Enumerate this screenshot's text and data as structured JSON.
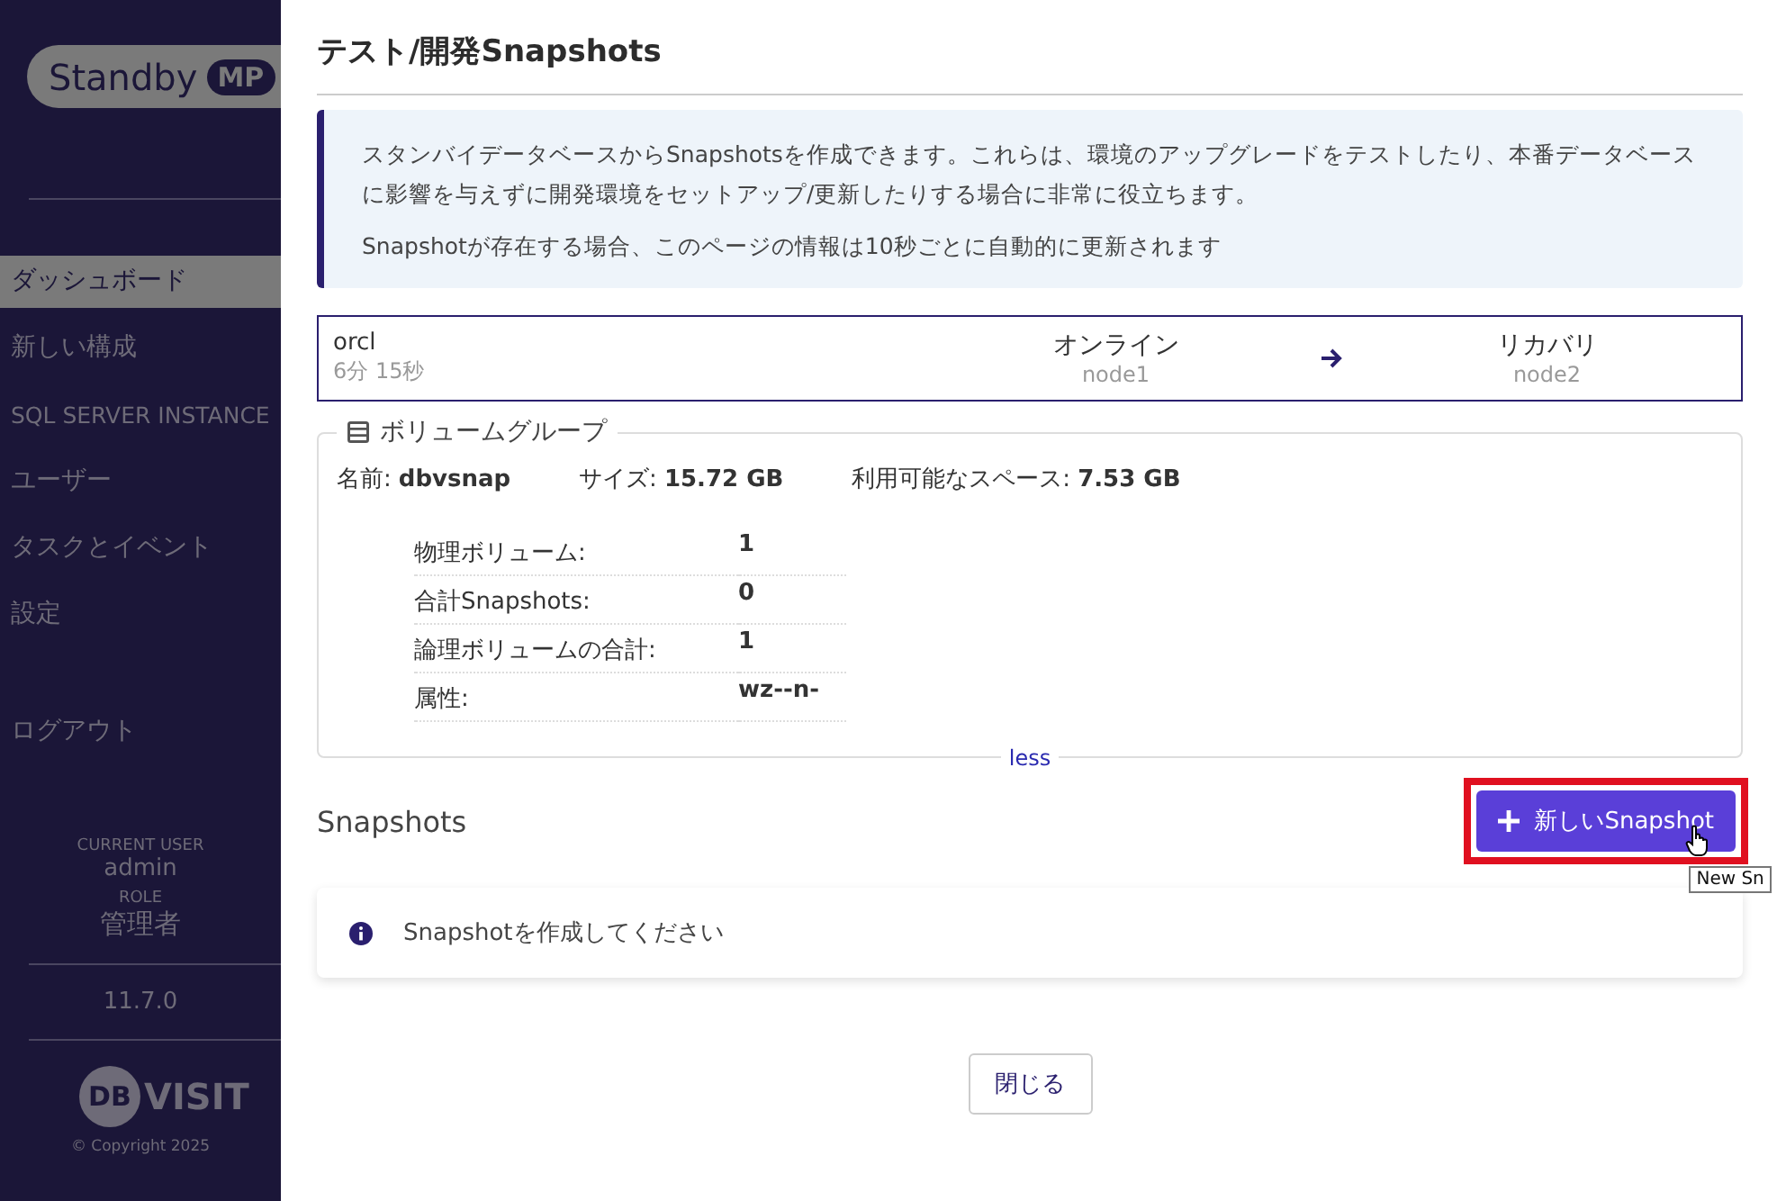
{
  "sidebar": {
    "logo": {
      "name": "Standby",
      "badge": "MP"
    },
    "items": [
      {
        "label": "ダッシュボード",
        "selected": true
      },
      {
        "label": "新しい構成",
        "selected": false
      },
      {
        "label": "SQL SERVER INSTANCE",
        "selected": false
      },
      {
        "label": "ユーザー",
        "selected": false
      },
      {
        "label": "タスクとイベント",
        "selected": false
      },
      {
        "label": "設定",
        "selected": false
      }
    ],
    "logout": "ログアウト",
    "user": {
      "caption": "CURRENT USER",
      "name": "admin",
      "role_caption": "ROLE",
      "role": "管理者"
    },
    "version": "11.7.0",
    "brand": {
      "mark": "DB",
      "word": "VISIT"
    },
    "copyright": "© Copyright 2025"
  },
  "dialog": {
    "title": "テスト/開発Snapshots",
    "info": [
      "スタンバイデータベースからSnapshotsを作成できます。これらは、環境のアップグレードをテストしたり、本番データベースに影響を与えずに開発環境をセットアップ/更新したりする場合に非常に役立ちます。",
      "Snapshotが存在する場合、このページの情報は10秒ごとに自動的に更新されます"
    ],
    "config": {
      "name": "orcl",
      "age": "6分 15秒",
      "source": {
        "status": "オンライン",
        "node": "node1"
      },
      "target": {
        "status": "リカバリ",
        "node": "node2"
      }
    },
    "volume_group": {
      "legend": "ボリュームグループ",
      "summary": [
        {
          "label": "名前:",
          "value": "dbvsnap"
        },
        {
          "label": "サイズ:",
          "value": "15.72 GB"
        },
        {
          "label": "利用可能なスペース:",
          "value": "7.53 GB"
        }
      ],
      "details": [
        {
          "label": "物理ボリューム:",
          "value": "1"
        },
        {
          "label": "合計Snapshots:",
          "value": "0"
        },
        {
          "label": "論理ボリュームの合計:",
          "value": "1"
        },
        {
          "label": "属性:",
          "value": "wz--n-"
        }
      ],
      "toggle": "less"
    },
    "snapshots": {
      "heading": "Snapshots",
      "new_button": "新しいSnapshot",
      "highlighted": true,
      "tooltip": "New Sn",
      "message": "Snapshotを作成してください"
    },
    "close_button": "閉じる"
  }
}
